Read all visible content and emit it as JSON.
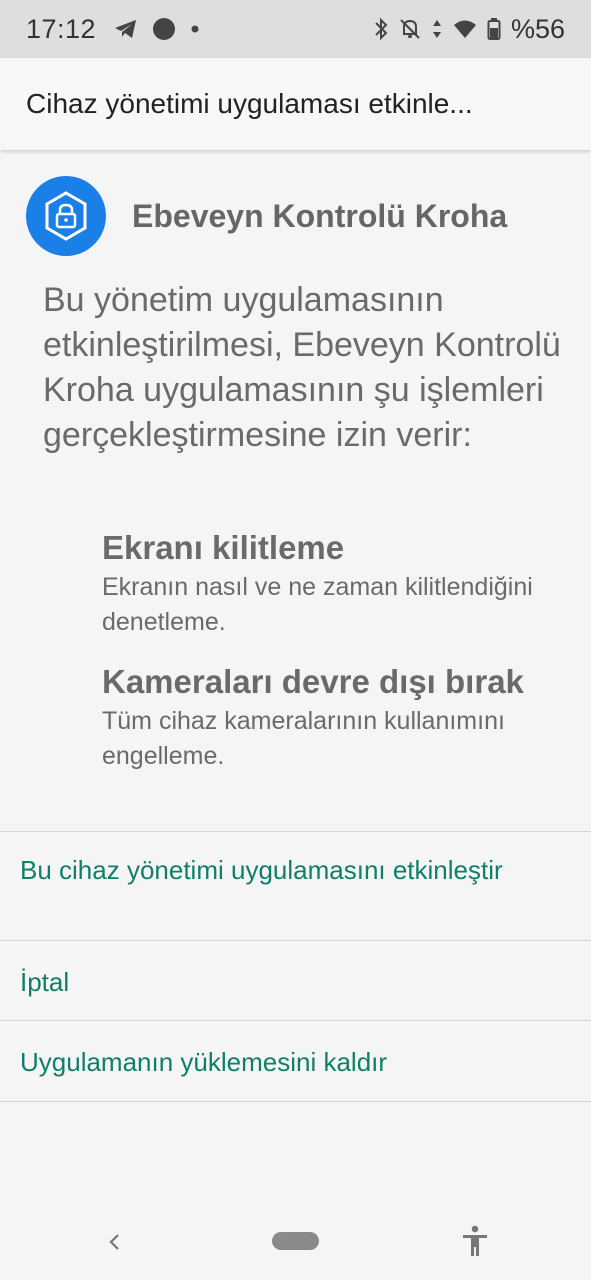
{
  "status_bar": {
    "time": "17:12",
    "battery": "%56",
    "icons": [
      "telegram-icon",
      "record-dot-icon",
      "small-dot-icon",
      "bluetooth-icon",
      "notifications-off-icon",
      "data-arrows-icon",
      "wifi-icon",
      "battery-icon"
    ]
  },
  "app_bar": {
    "title": "Cihaz yönetimi uygulaması etkinle..."
  },
  "app": {
    "name": "Ebeveyn Kontrolü Kroha",
    "icon": "lock-shield-icon",
    "icon_color": "#1a7fe6"
  },
  "description": "Bu yönetim uygulamasının etkinleştirilmesi, Ebeveyn Kontrolü Kroha uygulamasının şu işlemleri gerçekleştirmesine izin verir:",
  "permissions": [
    {
      "title": "Ekranı kilitleme",
      "desc": "Ekranın nasıl ve ne zaman kilitlendiğini denetleme."
    },
    {
      "title": "Kameraları devre dışı bırak",
      "desc": "Tüm cihaz kameralarının kullanımını engelleme."
    }
  ],
  "actions": {
    "activate": "Bu cihaz yönetimi uygulamasını etkinleştir",
    "cancel": "İptal",
    "uninstall": "Uygulamanın yüklemesini kaldır"
  },
  "colors": {
    "accent": "#0f7f6b",
    "text_secondary": "#6a6a6a"
  },
  "nav_bar": {
    "icons": [
      "back-icon",
      "home-pill-icon",
      "accessibility-icon"
    ]
  }
}
